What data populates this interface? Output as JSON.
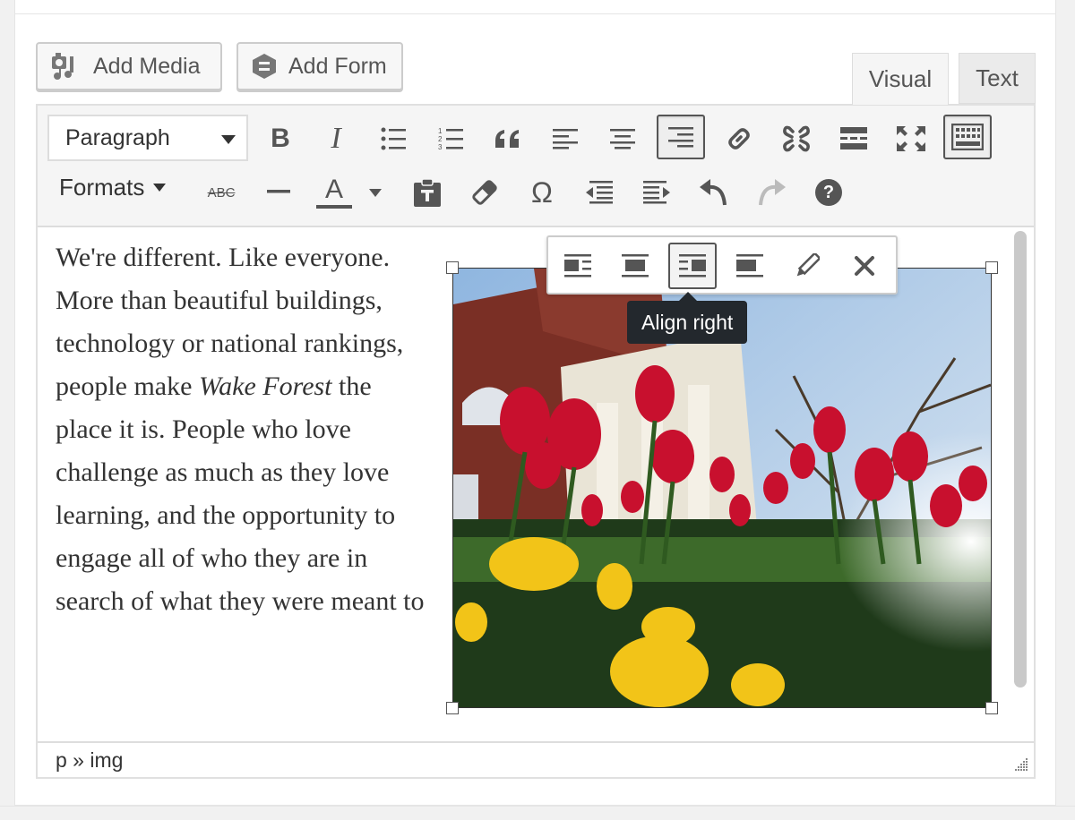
{
  "media_buttons": {
    "add_media": "Add Media",
    "add_form": "Add Form"
  },
  "tabs": {
    "visual": "Visual",
    "text": "Text"
  },
  "toolbar": {
    "format_select": "Paragraph",
    "formats_menu": "Formats",
    "row1_icons": [
      "bold-icon",
      "italic-icon",
      "bulleted-list-icon",
      "numbered-list-icon",
      "blockquote-icon",
      "align-left-icon",
      "align-center-icon",
      "align-right-icon",
      "insert-link-icon",
      "remove-link-icon",
      "read-more-icon",
      "fullscreen-icon",
      "toolbar-toggle-icon"
    ],
    "row2_icons": [
      "strikethrough-icon",
      "horizontal-line-icon",
      "text-color-icon",
      "paste-as-text-icon",
      "clear-formatting-icon",
      "special-character-icon",
      "decrease-indent-icon",
      "increase-indent-icon",
      "undo-icon",
      "redo-icon",
      "help-icon"
    ],
    "strikethrough_text": "ABC",
    "text_color_letter": "A",
    "special_char": "Ω",
    "help_char": "?",
    "bold_char": "B",
    "italic_char": "I"
  },
  "content": {
    "before_em": "We're different. Like everyone. More than beautiful buildings, technology or national rankings, people make ",
    "em": "Wake Forest",
    "after_em": " the place it is. People who love challenge as much as they love learning, and the opportunity to engage all of who they are in search of what they were meant to be."
  },
  "image_toolbar": {
    "icons": [
      "align-left-icon",
      "align-center-icon",
      "align-right-icon",
      "align-none-icon",
      "edit-icon",
      "remove-icon"
    ],
    "active": "align-right-icon",
    "tooltip": "Align right"
  },
  "statusbar": {
    "path": "p » img"
  },
  "colors": {
    "active_border": "#555555",
    "tooltip_bg": "#23282d"
  }
}
